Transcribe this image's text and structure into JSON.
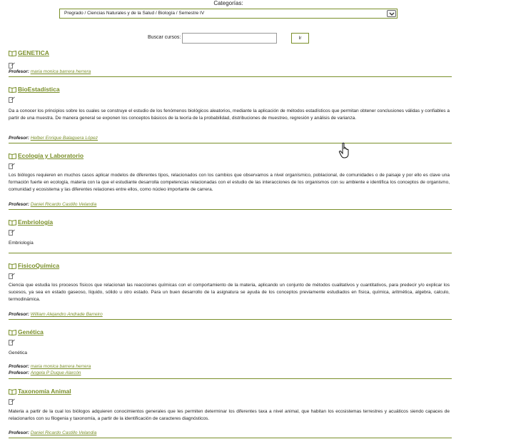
{
  "header": {
    "category_label": "Categorías:",
    "category_selected": "Pregrado / Ciencias Naturales y de la Salud / Biología / Semestre IV"
  },
  "search": {
    "label": "Buscar cursos:",
    "value": "",
    "button": "Ir"
  },
  "icons": {
    "course": "open-book-icon",
    "enter": "enter-course-icon",
    "dropdown": "chevron-down-icon",
    "cursor": "hand-pointer-icon"
  },
  "colors": {
    "accent": "#7a8f2a"
  },
  "courses": [
    {
      "name": "GENETICA",
      "summary": "",
      "teachers": [
        {
          "label": "Profesor:",
          "name": "maria monica barrera herrera"
        }
      ]
    },
    {
      "name": "BioEstadística",
      "summary": "Da a conocer los principios sobre los cuales se construye el estudio de los fenómenos biológicos aleatorios, mediante la aplicación de métodos estadísticos que permitan obtener conclusiones válidas y confiables a partir de una muestra. De manera general se exponen los conceptos básicos de la teoría de la probabilidad, distribuciones de muestreo, regresión y análisis de varianza.",
      "teachers": [
        {
          "label": "Profesor:",
          "name": "Helber Enrique Balaguera López"
        }
      ]
    },
    {
      "name": "Ecología y Laboratorio",
      "summary": "Los biólogos requieren en muchos casos aplicar modelos de diferentes tipos, relacionados con los cambios que observamos a nivel organísmico, poblacional, de comunidades o de paisaje y por ello es clave una formación fuerte en ecología, materia con la que el estudiante desarrolla competencias relacionadas con el estudio de las interacciones de los organismos con su ambiente e identifica los conceptos de organismo, comunidad y ecosistema y las diferentes relaciones entre ellos, como núcleo importante de carrera.",
      "teachers": [
        {
          "label": "Profesor:",
          "name": "Daniel Ricardo Castillo Velandia"
        }
      ]
    },
    {
      "name": "Embriología",
      "summary": "Embriología",
      "teachers": []
    },
    {
      "name": "FisicoQuímica",
      "summary": "Ciencia que estudia los procesos físicos que relacionan las reacciones químicas con el comportamiento de la materia, aplicando un conjunto de métodos cualitativos y cuantitativos, para predecir y/o explicar los sucesos, ya sea en estado gaseoso, líquido, sólido u otro estado. Para un buen desarrollo de la asignatura se ayuda de los conceptos previamente estudiados en física, química, aritmética, algebra, calculo, termodinámica.",
      "teachers": [
        {
          "label": "Profesor:",
          "name": "William Alejandro Andrade Barreiro"
        }
      ]
    },
    {
      "name": "Genética",
      "summary": "Genética",
      "teachers": [
        {
          "label": "Profesor:",
          "name": "maria monica barrera herrera"
        },
        {
          "label": "Profesor:",
          "name": "Angela P Duque Alarcón"
        }
      ]
    },
    {
      "name": "Taxonomía Animal",
      "summary": "Materia a partir de la cual los biólogos adquieren conocimientos generales que les permiten determinar los diferentes taxa a nivel animal, que habitan los ecosistemas terrestres y acuáticos siendo capaces de relacionarlos con su filogenia y taxonomía, a partir de la identificación de caracteres diagnósticos.",
      "teachers": [
        {
          "label": "Profesor:",
          "name": "Daniel Ricardo Castillo Velandia"
        }
      ]
    }
  ]
}
